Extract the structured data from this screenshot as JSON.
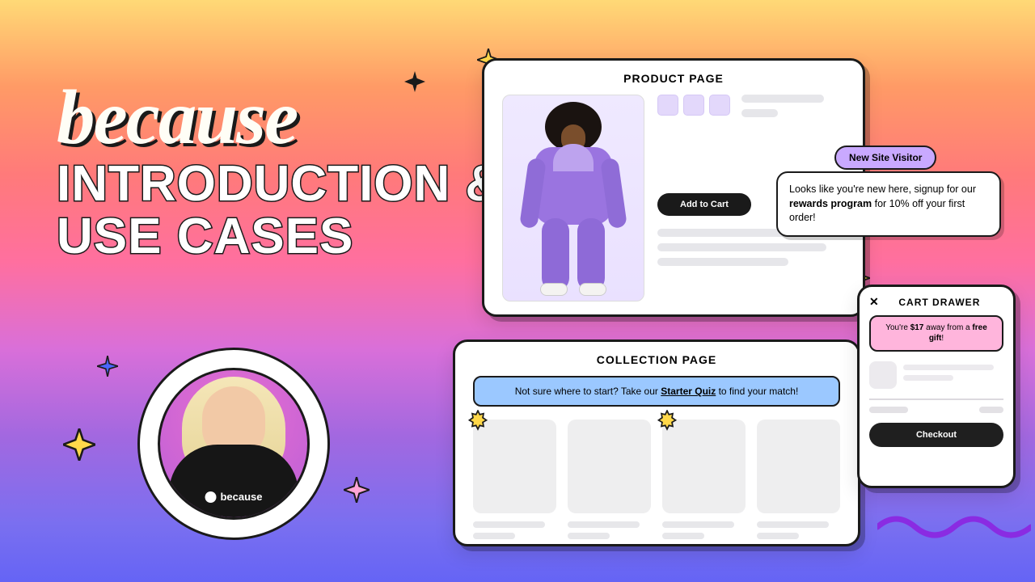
{
  "brand": {
    "logo_text": "because",
    "avatar_brand_label": "because"
  },
  "headline": "INTRODUCTION & USE CASES",
  "product_panel": {
    "title": "PRODUCT PAGE",
    "add_to_cart": "Add to Cart"
  },
  "visitor_chip": "New Site Visitor",
  "visitor_callout": {
    "pre": "Looks like you're new here, signup for our ",
    "bold": "rewards program",
    "post": " for 10% off your first order!"
  },
  "collection_panel": {
    "title": "COLLECTION PAGE",
    "quiz_pre": "Not sure where to start? Take our ",
    "quiz_bold": "Starter Quiz",
    "quiz_post": " to find your match!"
  },
  "cart_panel": {
    "title": "CART DRAWER",
    "close": "✕",
    "gift_pre": "You're ",
    "gift_amount": "$17",
    "gift_mid": " away from a ",
    "gift_bold": "free gift",
    "gift_post": "!",
    "checkout": "Checkout"
  }
}
